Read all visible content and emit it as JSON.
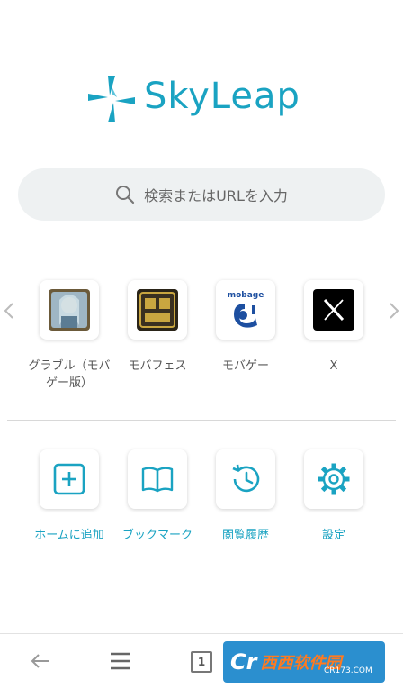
{
  "app": {
    "logo_text": "SkyLeap"
  },
  "search": {
    "placeholder": "検索またはURLを入力"
  },
  "shortcuts": [
    {
      "label": "グラブル（モバゲー版）"
    },
    {
      "label": "モバフェス"
    },
    {
      "label": "モバゲー",
      "icon_text": "mobage"
    },
    {
      "label": "X"
    }
  ],
  "actions": [
    {
      "label": "ホームに追加"
    },
    {
      "label": "ブックマーク"
    },
    {
      "label": "閲覧履歴"
    },
    {
      "label": "設定"
    }
  ],
  "bottom_bar": {
    "tab_count": "1"
  },
  "watermark": {
    "text": "西西软件园",
    "sub": "CR173.COM",
    "cr": "Cr"
  },
  "colors": {
    "accent": "#1aa3c2",
    "search_bg": "#eef1f2"
  }
}
